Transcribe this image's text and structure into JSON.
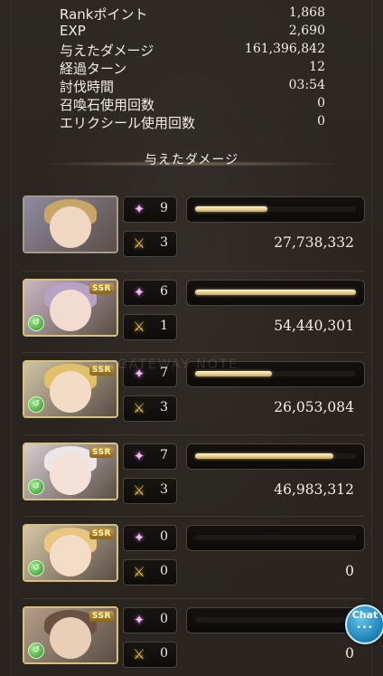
{
  "stats": [
    {
      "label": "Rankポイント",
      "value": "1,868"
    },
    {
      "label": "EXP",
      "value": "2,690"
    },
    {
      "label": "与えたダメージ",
      "value": "161,396,842"
    },
    {
      "label": "経過ターン",
      "value": "12"
    },
    {
      "label": "討伐時間",
      "value": "03:54"
    },
    {
      "label": "召喚石使用回数",
      "value": "0"
    },
    {
      "label": "エリクシール使用回数",
      "value": "0"
    }
  ],
  "damage_section": {
    "title": "与えたダメージ"
  },
  "watermark": "GATEWAY NOTE",
  "entries": [
    {
      "type": "party",
      "star_count": "9",
      "attack_count": "3",
      "damage": "27,738,332",
      "bar_fill": 0.45,
      "colors": {
        "bg": "#8f8aa0",
        "hair": "#c8a66a",
        "face": "#f0d7c2"
      }
    },
    {
      "type": "ssr",
      "ssr_label": "SSR",
      "element_icon": "wind",
      "star_count": "6",
      "attack_count": "1",
      "damage": "54,440,301",
      "bar_fill": 1.0,
      "colors": {
        "bg": "#c9b6c2",
        "hair": "#b7a2c6",
        "face": "#f2dbd0"
      }
    },
    {
      "type": "ssr",
      "ssr_label": "SSR",
      "element_icon": "wind",
      "star_count": "7",
      "attack_count": "3",
      "damage": "26,053,084",
      "bar_fill": 0.48,
      "colors": {
        "bg": "#cfc3a4",
        "hair": "#e0c06a",
        "face": "#f2dcc6"
      }
    },
    {
      "type": "ssr",
      "ssr_label": "SSR",
      "element_icon": "wind",
      "star_count": "7",
      "attack_count": "3",
      "damage": "46,983,312",
      "bar_fill": 0.86,
      "colors": {
        "bg": "#d6cdd0",
        "hair": "#ece6e8",
        "face": "#f4e1d8"
      }
    },
    {
      "type": "ssr",
      "ssr_label": "SSR",
      "element_icon": "wind",
      "star_count": "0",
      "attack_count": "0",
      "damage": "0",
      "bar_fill": 0.0,
      "colors": {
        "bg": "#d7c6a6",
        "hair": "#e9c781",
        "face": "#f4ddc6"
      }
    },
    {
      "type": "ssr",
      "ssr_label": "SSR",
      "element_icon": "wind",
      "star_count": "0",
      "attack_count": "0",
      "damage": "0",
      "bar_fill": 0.0,
      "colors": {
        "bg": "#b49d86",
        "hair": "#6b5142",
        "face": "#e9cfb8"
      }
    }
  ],
  "chat_button": {
    "label": "Chat",
    "dots": "•••"
  },
  "icons": {
    "star": "sparkle-icon",
    "attack": "crossed-swords-icon",
    "element": "wind-element-icon"
  }
}
